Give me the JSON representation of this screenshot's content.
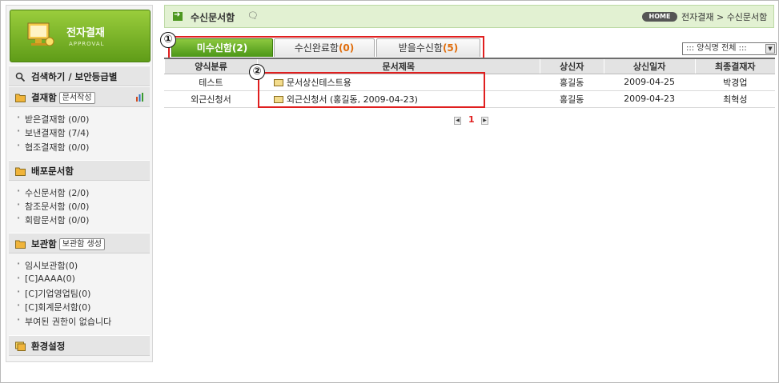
{
  "sidebar": {
    "logo_title": "전자결재",
    "logo_sub": "APPROVAL",
    "search_label": "검색하기 / 보안등급별",
    "approval_box": {
      "label": "결재함",
      "tag": "문서작성"
    },
    "approval_items": [
      "받은결재함 (0/0)",
      "보낸결재함 (7/4)",
      "협조결재함 (0/0)"
    ],
    "distribution_box": {
      "label": "배포문서함"
    },
    "distribution_items": [
      "수신문서함 (2/0)",
      "참조문서함 (0/0)",
      "회람문서함 (0/0)"
    ],
    "storage_box": {
      "label": "보관함",
      "tag": "보관함 생성"
    },
    "storage_items": [
      "임시보관함(0)",
      "[C]AAAA(0)",
      "[C]기업영업팀(0)",
      "[C]회계문서함(0)",
      "부여된 권한이 없습니다"
    ],
    "settings_label": "환경설정"
  },
  "header": {
    "title": "수신문서함",
    "home": "HOME",
    "breadcrumb": "전자결재 > 수신문서함"
  },
  "tabs": [
    {
      "label": "미수신함",
      "count": "(2)"
    },
    {
      "label": "수신완료함",
      "count": "(0)"
    },
    {
      "label": "받을수신함",
      "count": "(5)"
    }
  ],
  "markers": [
    "①",
    "②"
  ],
  "filter": {
    "selected": "::: 양식명 전체 :::"
  },
  "table": {
    "headers": [
      "양식분류",
      "문서제목",
      "상신자",
      "상신일자",
      "최종결재자"
    ],
    "rows": [
      {
        "category": "테스트",
        "title": "문서상신테스트용",
        "sender": "홍길동",
        "date": "2009-04-25",
        "approver": "박경업"
      },
      {
        "category": "외근신청서",
        "title": "외근신청서 (홍길동, 2009-04-23)",
        "sender": "홍길동",
        "date": "2009-04-23",
        "approver": "최혁성"
      }
    ]
  },
  "pager": {
    "current": "1"
  },
  "colors": {
    "accent_green": "#5f9c18",
    "highlight_red": "#e01f1f",
    "count_orange": "#e06d0c"
  }
}
